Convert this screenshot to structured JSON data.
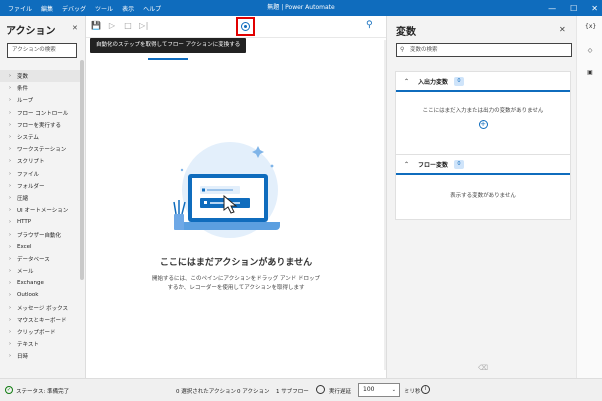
{
  "window": {
    "menus": [
      "ファイル",
      "編集",
      "デバッグ",
      "ツール",
      "表示",
      "ヘルプ"
    ],
    "title": "無題 | Power Automate"
  },
  "actions_pane": {
    "title": "アクション",
    "search_placeholder": "アクションの検索",
    "items": [
      "変数",
      "条件",
      "ループ",
      "フロー コントロール",
      "フローを実行する",
      "システム",
      "ワークステーション",
      "スクリプト",
      "ファイル",
      "フォルダー",
      "圧縮",
      "UI オートメーション",
      "HTTP",
      "ブラウザー自動化",
      "Excel",
      "データベース",
      "メール",
      "Exchange",
      "Outlook",
      "メッセージ ボックス",
      "マウスとキーボード",
      "クリップボード",
      "テキスト",
      "日時"
    ]
  },
  "toolbar": {
    "tooltip": "自動化のステップを取得してフロー アクションに変換する"
  },
  "canvas": {
    "empty_title": "ここにはまだアクションがありません",
    "empty_desc_line1": "開始するには、このペインにアクションをドラッグ アンド ドロップ",
    "empty_desc_line2": "するか、レコーダーを使用してアクションを取得します"
  },
  "variables_pane": {
    "title": "変数",
    "search_placeholder": "変数の検索",
    "io_section": {
      "label": "入出力変数",
      "count": "0",
      "empty": "ここにはまだ入力または出力の変数がありません"
    },
    "flow_section": {
      "label": "フロー変数",
      "count": "0",
      "empty": "表示する変数がありません"
    }
  },
  "rail": {
    "vars_icon_label": "{x}"
  },
  "statusbar": {
    "status": "ステータス: 準備完了",
    "selected": "0 選択されたアクション",
    "actions": "0 アクション",
    "subflows": "1 サブフロー",
    "delay_label": "実行遅延",
    "delay_value": "100",
    "unit": "ミリ秒"
  }
}
